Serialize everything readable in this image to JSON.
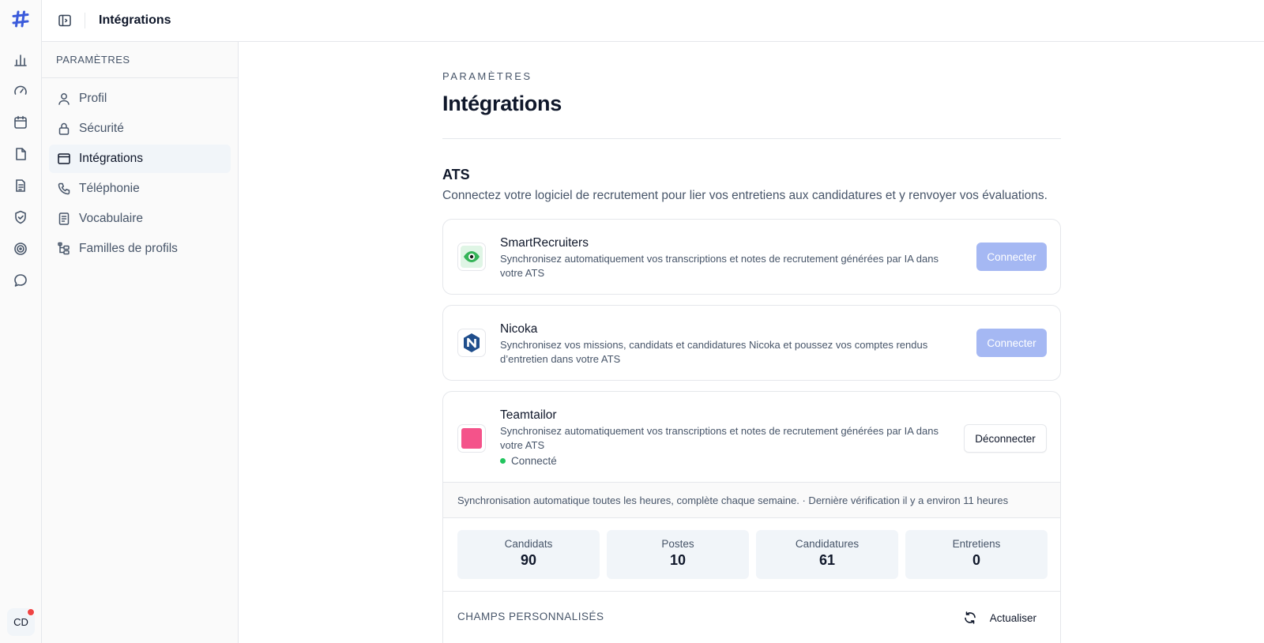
{
  "topbar": {
    "title": "Intégrations"
  },
  "rail": {
    "icons": [
      "chart-icon",
      "gauge-icon",
      "calendar-icon",
      "file-icon",
      "document-icon",
      "shield-check-icon",
      "target-icon",
      "chat-icon"
    ],
    "avatar_initials": "CD",
    "accent": "#3b5bdb"
  },
  "sidebar": {
    "header": "PARAMÈTRES",
    "items": [
      {
        "label": "Profil",
        "icon": "user-icon"
      },
      {
        "label": "Sécurité",
        "icon": "lock-icon"
      },
      {
        "label": "Intégrations",
        "icon": "browser-window-icon",
        "active": true
      },
      {
        "label": "Téléphonie",
        "icon": "phone-icon"
      },
      {
        "label": "Vocabulaire",
        "icon": "book-icon"
      },
      {
        "label": "Familles de profils",
        "icon": "hierarchy-icon"
      }
    ]
  },
  "page": {
    "eyebrow": "PARAMÈTRES",
    "title": "Intégrations",
    "section_title": "ATS",
    "section_desc": "Connectez votre logiciel de recrutement pour lier vos entretiens aux candidatures et y renvoyer vos évaluations."
  },
  "integrations": [
    {
      "name": "SmartRecruiters",
      "desc": "Synchronisez automatiquement vos transcriptions et notes de recrutement générées par IA dans votre ATS",
      "button": "Connecter"
    },
    {
      "name": "Nicoka",
      "desc": "Synchronisez vos missions, candidats et candidatures Nicoka et poussez vos comptes rendus d’entretien dans votre ATS",
      "button": "Connecter"
    },
    {
      "name": "Teamtailor",
      "logo_text": "Teamtailor",
      "desc": "Synchronisez automatiquement vos transcriptions et notes de recrutement générées par IA dans votre ATS",
      "button": "Déconnecter",
      "status": "Connecté",
      "sync_info": "Synchronisation automatique toutes les heures, complète chaque semaine. · Dernière vérification il y a environ 11 heures",
      "stats": [
        {
          "label": "Candidats",
          "value": "90"
        },
        {
          "label": "Postes",
          "value": "10"
        },
        {
          "label": "Candidatures",
          "value": "61"
        },
        {
          "label": "Entretiens",
          "value": "0"
        }
      ],
      "custom_fields_label": "CHAMPS PERSONNALISÉS",
      "refresh_label": "Actualiser"
    }
  ]
}
